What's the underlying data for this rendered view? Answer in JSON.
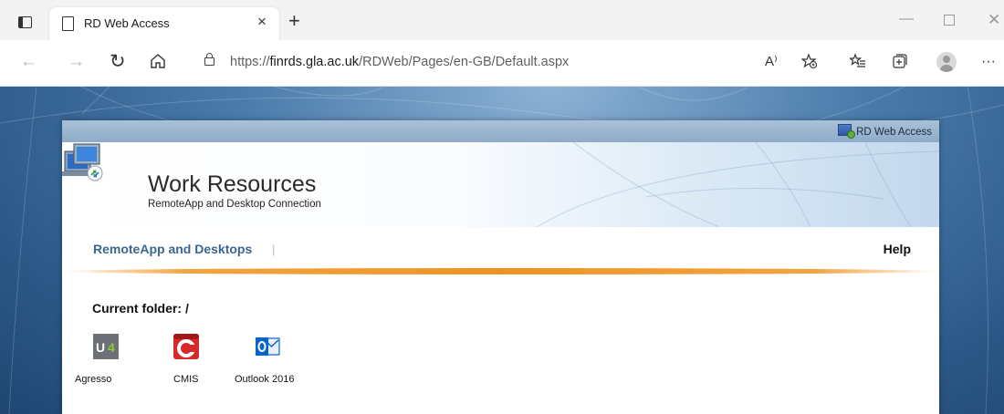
{
  "browser": {
    "tab_title": "RD Web Access",
    "tab_close": "×",
    "new_tab": "+",
    "url_prefix": "https://",
    "url_domain": "finrds.gla.ac.uk",
    "url_path": "/RDWeb/Pages/en-GB/Default.aspx",
    "read_aloud": "A⁾",
    "more": "···",
    "icons": [
      "tab-actions-icon",
      "page-icon",
      "back-icon",
      "forward-icon",
      "refresh-icon",
      "home-icon",
      "lock-icon",
      "read-aloud-icon",
      "add-favorite-icon",
      "favorites-icon",
      "collections-icon",
      "profile-icon",
      "more-icon"
    ]
  },
  "header": {
    "rd_web_access": "RD Web Access",
    "title": "Work Resources",
    "subtitle": "RemoteApp and Desktop Connection"
  },
  "nav": {
    "remoteapp": "RemoteApp and Desktops",
    "separator": "|",
    "help": "Help"
  },
  "folder": {
    "label": "Current folder:",
    "path": "/"
  },
  "apps": [
    {
      "label": "Agresso",
      "icon": "agresso-icon",
      "color": "#6d7175"
    },
    {
      "label": "CMIS",
      "icon": "cmis-icon",
      "color": "#d92a2a"
    },
    {
      "label": "Outlook 2016",
      "icon": "outlook-icon",
      "color": "#0a64c8"
    }
  ]
}
